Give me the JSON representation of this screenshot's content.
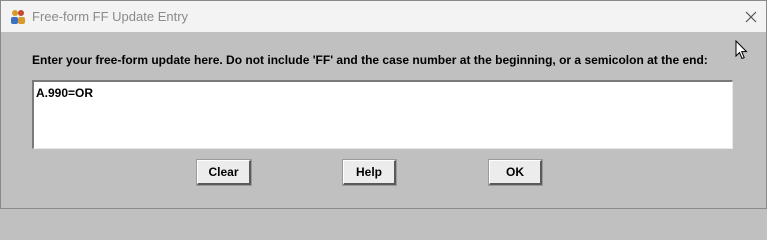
{
  "window": {
    "title": "Free-form FF Update Entry",
    "close_icon": "close-icon",
    "app_icon": "people-icon"
  },
  "dialog": {
    "prompt": "Enter your free-form update here.  Do not include 'FF' and the case number at the beginning, or a semicolon at the end:",
    "input_value": "A.990=OR"
  },
  "buttons": {
    "clear_label": "Clear",
    "help_label": "Help",
    "ok_label": "OK"
  },
  "colors": {
    "background": "#c0c0c0",
    "titlebar": "#f3f3f3",
    "title_text": "#8a8a8a"
  }
}
